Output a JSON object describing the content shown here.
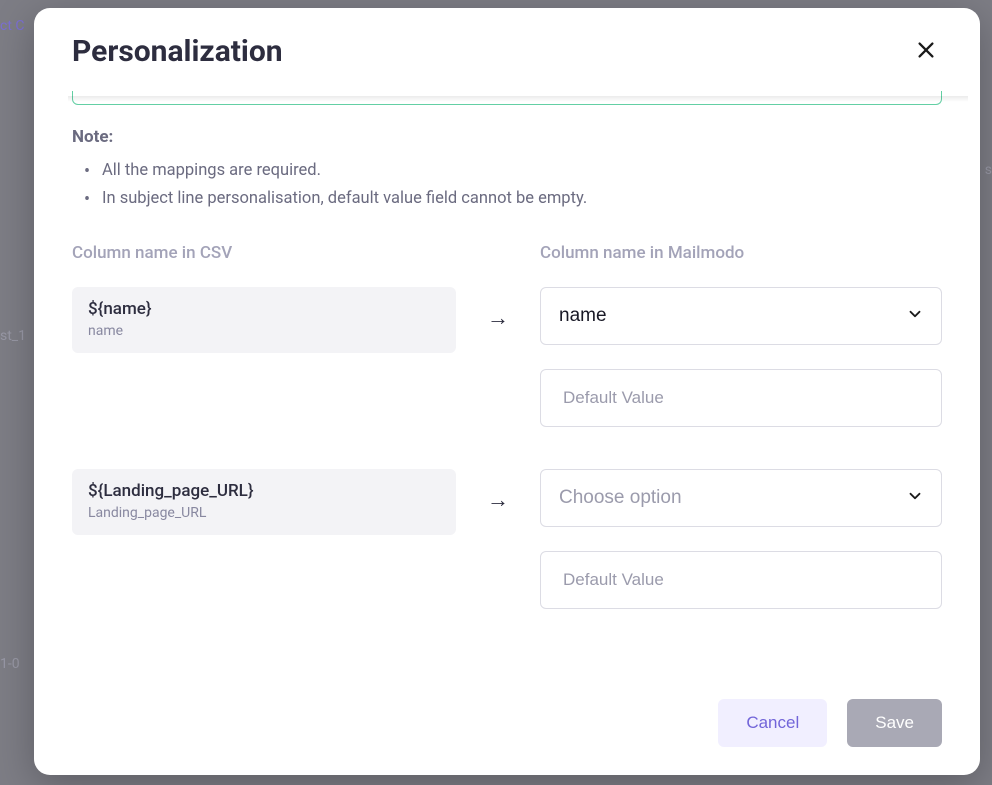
{
  "modal": {
    "title": "Personalization",
    "note": {
      "title": "Note:",
      "items": [
        "All the mappings are required.",
        "In subject line personalisation, default value field cannot be empty."
      ]
    },
    "headers": {
      "left": "Column name in CSV",
      "right": "Column name in Mailmodo"
    },
    "mappings": [
      {
        "csv_template": "${name}",
        "csv_field": "name",
        "selected": "name",
        "placeholder": "Choose option",
        "default_value": "",
        "default_placeholder": "Default Value",
        "has_selection": true
      },
      {
        "csv_template": "${Landing_page_URL}",
        "csv_field": "Landing_page_URL",
        "selected": "",
        "placeholder": "Choose option",
        "default_value": "",
        "default_placeholder": "Default Value",
        "has_selection": false
      }
    ],
    "footer": {
      "cancel": "Cancel",
      "save": "Save"
    }
  },
  "background": {
    "text1": "ct C",
    "text2": "st_1",
    "text3": "1-0",
    "text4": "s"
  }
}
